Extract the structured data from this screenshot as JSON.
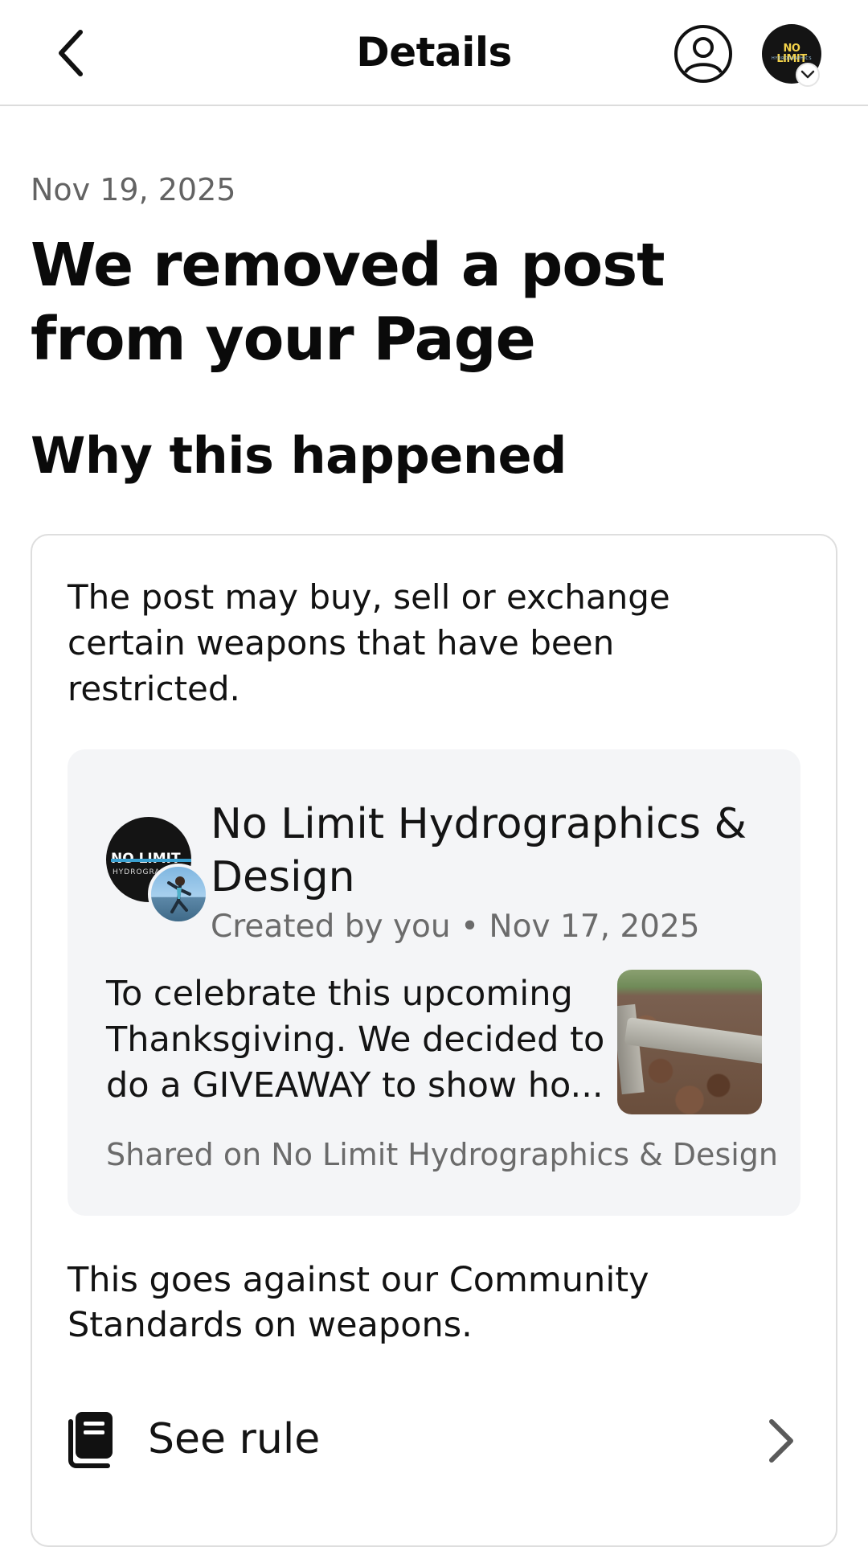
{
  "header": {
    "title": "Details",
    "back_icon": "chevron-left-icon",
    "profile_icon": "user-circle-icon",
    "page_avatar_logo": "NO LIMIT",
    "page_avatar_sub": "HYDROGRAPHICS"
  },
  "notice": {
    "date": "Nov 19, 2025",
    "headline": "We removed a post from your Page",
    "section_title": "Why this happened",
    "reason": "The post may buy, sell or exchange certain weapons that have been restricted.",
    "standards": "This goes against our Community Standards on weapons."
  },
  "post": {
    "page_name": "No Limit Hydrographics & Design",
    "meta": "Created by you • Nov 17, 2025",
    "text": "To celebrate this upcoming Thanksgiving. We decided to do a GIVEAWAY to show ho...",
    "shared_on": "Shared on No Limit Hydrographics & Design",
    "avatar_logo": "NO LIMIT",
    "avatar_sub": "HYDROGRAPHICS"
  },
  "rule_link": {
    "label": "See rule",
    "icon": "book-icon",
    "chevron": "chevron-right-icon"
  },
  "colors": {
    "secondary_text": "#636363",
    "card_border": "#dedede",
    "post_background": "#f4f5f7"
  }
}
